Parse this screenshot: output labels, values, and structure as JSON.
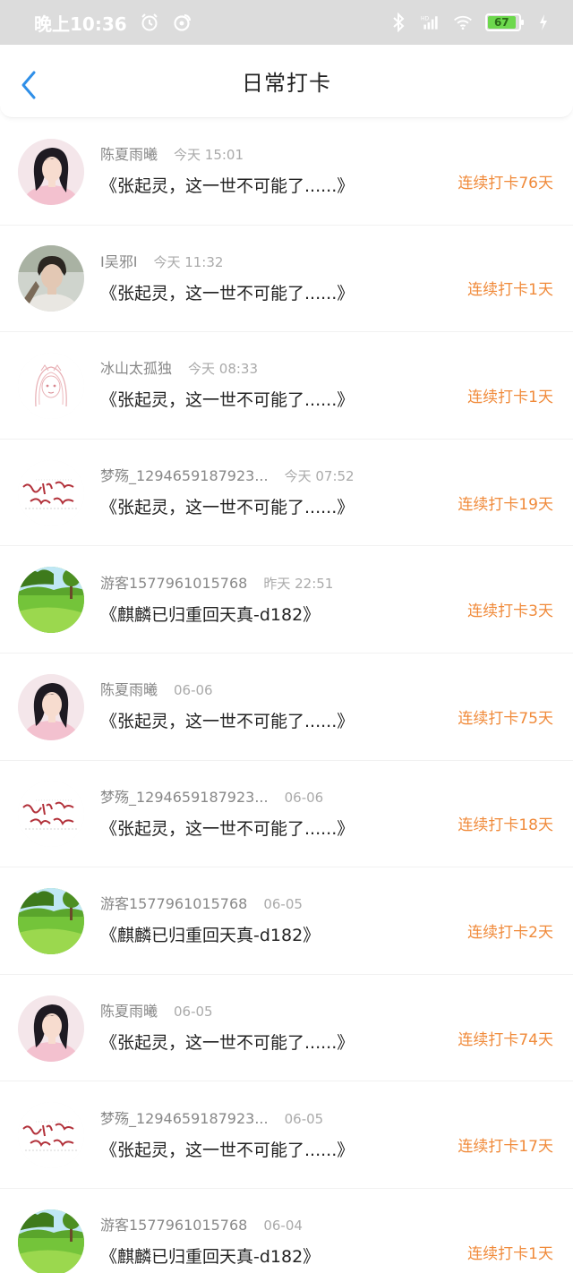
{
  "status": {
    "time": "晚上10:36",
    "battery": "67"
  },
  "header": {
    "title": "日常打卡"
  },
  "items": [
    {
      "name": "陈夏雨曦",
      "time": "今天 15:01",
      "title": "《张起灵，这一世不可能了......》",
      "streak": "连续打卡76天",
      "avatar": "portrait-girl"
    },
    {
      "name": "I吴邪I",
      "time": "今天 11:32",
      "title": "《张起灵，这一世不可能了......》",
      "streak": "连续打卡1天",
      "avatar": "portrait-boy"
    },
    {
      "name": "冰山太孤独",
      "time": "今天 08:33",
      "title": "《张起灵，这一世不可能了......》",
      "streak": "连续打卡1天",
      "avatar": "anime-sketch"
    },
    {
      "name": "梦殇_1294659187923...",
      "time": "今天 07:52",
      "title": "《张起灵，这一世不可能了......》",
      "streak": "连续打卡19天",
      "avatar": "calligraphy"
    },
    {
      "name": "游客1577961015768",
      "time": "昨天 22:51",
      "title": "《麒麟已归重回天真-d182》",
      "streak": "连续打卡3天",
      "avatar": "landscape"
    },
    {
      "name": "陈夏雨曦",
      "time": "06-06",
      "title": "《张起灵，这一世不可能了......》",
      "streak": "连续打卡75天",
      "avatar": "portrait-girl"
    },
    {
      "name": "梦殇_1294659187923...",
      "time": "06-06",
      "title": "《张起灵，这一世不可能了......》",
      "streak": "连续打卡18天",
      "avatar": "calligraphy"
    },
    {
      "name": "游客1577961015768",
      "time": "06-05",
      "title": "《麒麟已归重回天真-d182》",
      "streak": "连续打卡2天",
      "avatar": "landscape"
    },
    {
      "name": "陈夏雨曦",
      "time": "06-05",
      "title": "《张起灵，这一世不可能了......》",
      "streak": "连续打卡74天",
      "avatar": "portrait-girl"
    },
    {
      "name": "梦殇_1294659187923...",
      "time": "06-05",
      "title": "《张起灵，这一世不可能了......》",
      "streak": "连续打卡17天",
      "avatar": "calligraphy"
    },
    {
      "name": "游客1577961015768",
      "time": "06-04",
      "title": "《麒麟已归重回天真-d182》",
      "streak": "连续打卡1天",
      "avatar": "landscape"
    }
  ],
  "colors": {
    "accent": "#2f8fe8",
    "streak": "#f08a3a"
  }
}
